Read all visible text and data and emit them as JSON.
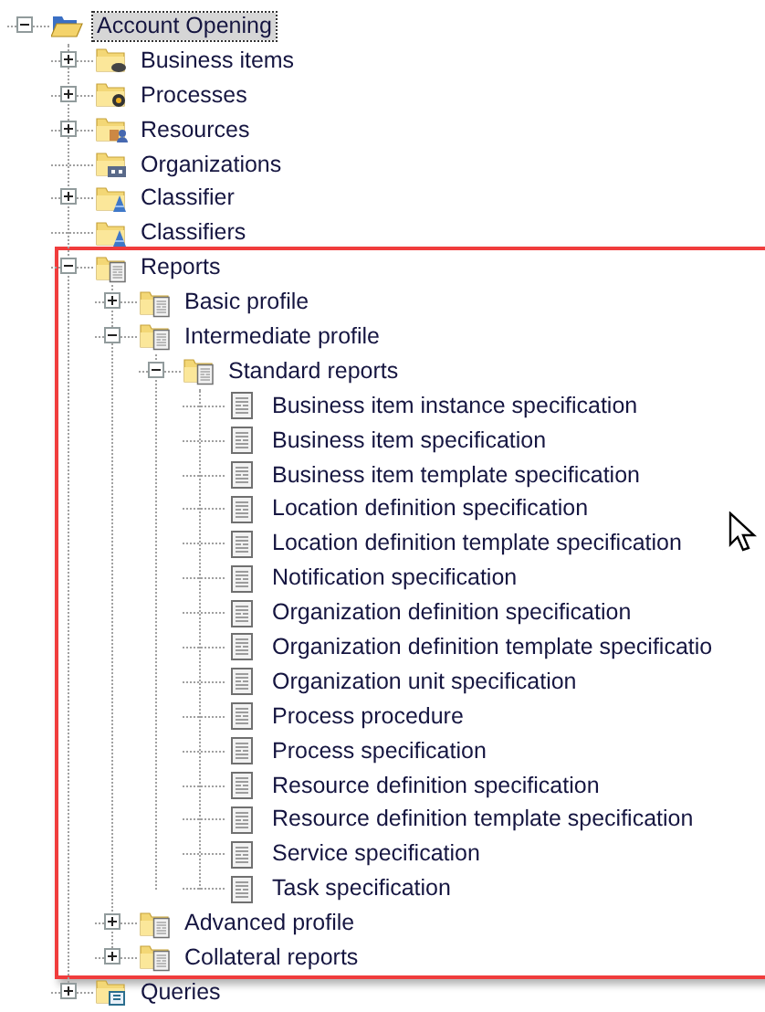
{
  "tree": [
    {
      "label": "Account Opening",
      "kind": "open-folder",
      "expanded": true,
      "selected": true,
      "children": [
        {
          "label": "Business items",
          "kind": "items-folder",
          "expanded": false,
          "selected": false
        },
        {
          "label": "Processes",
          "kind": "process-folder",
          "expanded": false,
          "selected": false
        },
        {
          "label": "Resources",
          "kind": "resource-folder",
          "expanded": false,
          "selected": false
        },
        {
          "label": "Organizations",
          "kind": "org-folder",
          "selected": false
        },
        {
          "label": "Classifier",
          "kind": "classifier-folder",
          "expanded": false,
          "selected": false
        },
        {
          "label": "Classifiers",
          "kind": "classifier-folder",
          "selected": false
        },
        {
          "label": "Reports",
          "kind": "report-folder",
          "expanded": true,
          "selected": false,
          "highlighted": true,
          "children": [
            {
              "label": "Basic profile",
              "kind": "report-folder",
              "expanded": false,
              "selected": false
            },
            {
              "label": "Intermediate profile",
              "kind": "report-folder",
              "expanded": true,
              "selected": false,
              "children": [
                {
                  "label": "Standard reports",
                  "kind": "report-folder",
                  "expanded": true,
                  "selected": false,
                  "children": [
                    {
                      "label": "Business item instance specification",
                      "kind": "report",
                      "selected": false
                    },
                    {
                      "label": "Business item specification",
                      "kind": "report",
                      "selected": false
                    },
                    {
                      "label": "Business item template specification",
                      "kind": "report",
                      "selected": false
                    },
                    {
                      "label": "Location definition specification",
                      "kind": "report",
                      "selected": false
                    },
                    {
                      "label": "Location definition template specification",
                      "kind": "report",
                      "selected": false
                    },
                    {
                      "label": "Notification specification",
                      "kind": "report",
                      "selected": false
                    },
                    {
                      "label": "Organization definition specification",
                      "kind": "report",
                      "selected": false
                    },
                    {
                      "label": "Organization definition template specificatio",
                      "kind": "report",
                      "selected": false
                    },
                    {
                      "label": "Organization unit specification",
                      "kind": "report",
                      "selected": false
                    },
                    {
                      "label": "Process procedure",
                      "kind": "report",
                      "selected": false
                    },
                    {
                      "label": "Process specification",
                      "kind": "report",
                      "selected": false
                    },
                    {
                      "label": "Resource definition specification",
                      "kind": "report",
                      "selected": false
                    },
                    {
                      "label": "Resource definition template specification",
                      "kind": "report",
                      "selected": false
                    },
                    {
                      "label": "Service specification",
                      "kind": "report",
                      "selected": false
                    },
                    {
                      "label": "Task specification",
                      "kind": "report",
                      "selected": false
                    }
                  ]
                }
              ]
            },
            {
              "label": "Advanced profile",
              "kind": "report-folder",
              "expanded": false,
              "selected": false
            },
            {
              "label": "Collateral reports",
              "kind": "report-folder",
              "expanded": false,
              "selected": false
            }
          ]
        },
        {
          "label": "Queries",
          "kind": "query-folder",
          "expanded": false,
          "selected": false
        }
      ]
    }
  ]
}
